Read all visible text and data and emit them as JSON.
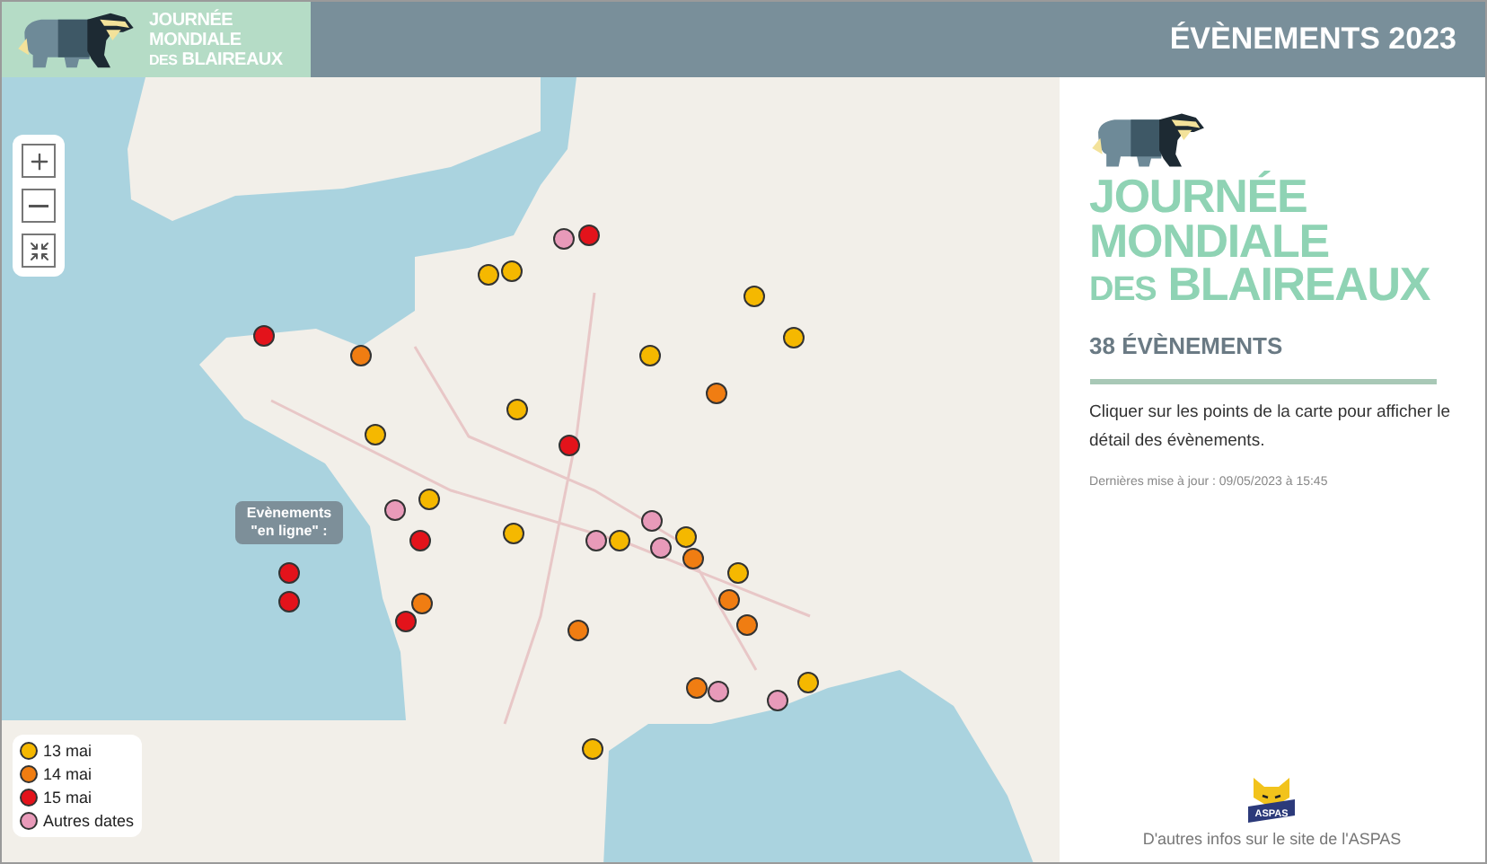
{
  "header": {
    "logo": {
      "line_1": "JOURNÉE",
      "line_2": "MONDIALE",
      "prefix": "DES",
      "name": "BLAIREAUX"
    },
    "title": "ÉVÈNEMENTS 2023"
  },
  "map": {
    "markers": [
      {
        "color": "#e89ab9"
      },
      {
        "color": "#e3131b"
      },
      {
        "color": "#f5b800"
      },
      {
        "color": "#f5b800"
      },
      {
        "color": "#f5b800"
      },
      {
        "color": "#e3131b"
      },
      {
        "color": "#f07d12"
      },
      {
        "color": "#f5b800"
      },
      {
        "color": "#f5b800"
      },
      {
        "color": "#f07d12"
      },
      {
        "color": "#f5b800"
      },
      {
        "color": "#f5b800"
      },
      {
        "color": "#e3131b"
      },
      {
        "color": "#f5b800"
      },
      {
        "color": "#e89ab9"
      },
      {
        "color": "#e3131b"
      },
      {
        "color": "#f5b800"
      },
      {
        "color": "#e89ab9"
      },
      {
        "color": "#f5b800"
      },
      {
        "color": "#e89ab9"
      },
      {
        "color": "#e89ab9"
      },
      {
        "color": "#f5b800"
      },
      {
        "color": "#f07d12"
      },
      {
        "color": "#f07d12"
      },
      {
        "color": "#e3131b"
      },
      {
        "color": "#f5b800"
      },
      {
        "color": "#f07d12"
      },
      {
        "color": "#f07d12"
      },
      {
        "color": "#f07d12"
      },
      {
        "color": "#f5b800"
      },
      {
        "color": "#f07d12"
      },
      {
        "color": "#e89ab9"
      },
      {
        "color": "#e89ab9"
      },
      {
        "color": "#f5b800"
      }
    ],
    "online_events": {
      "label": "Evènements \"en ligne\" :",
      "markers": [
        {
          "color": "#e3131b"
        },
        {
          "color": "#e3131b"
        }
      ]
    },
    "legend": [
      {
        "label": "13 mai",
        "color": "#f5b800"
      },
      {
        "label": "14 mai",
        "color": "#f07d12"
      },
      {
        "label": "15 mai",
        "color": "#e3131b"
      },
      {
        "label": "Autres dates",
        "color": "#e89ab9"
      }
    ]
  },
  "panel": {
    "logo": {
      "line_1": "JOURNÉE",
      "line_2": "MONDIALE",
      "prefix": "DES",
      "name": "BLAIREAUX"
    },
    "count": "38 ÉVÈNEMENTS",
    "instructions": "Cliquer sur les points de la carte pour afficher le détail des évènements.",
    "updated": "Dernières mise à jour : 09/05/2023 à 15:45",
    "partner_logo_text": "ASPAS",
    "partner_link": "D'autres infos sur le site de l'ASPAS"
  }
}
